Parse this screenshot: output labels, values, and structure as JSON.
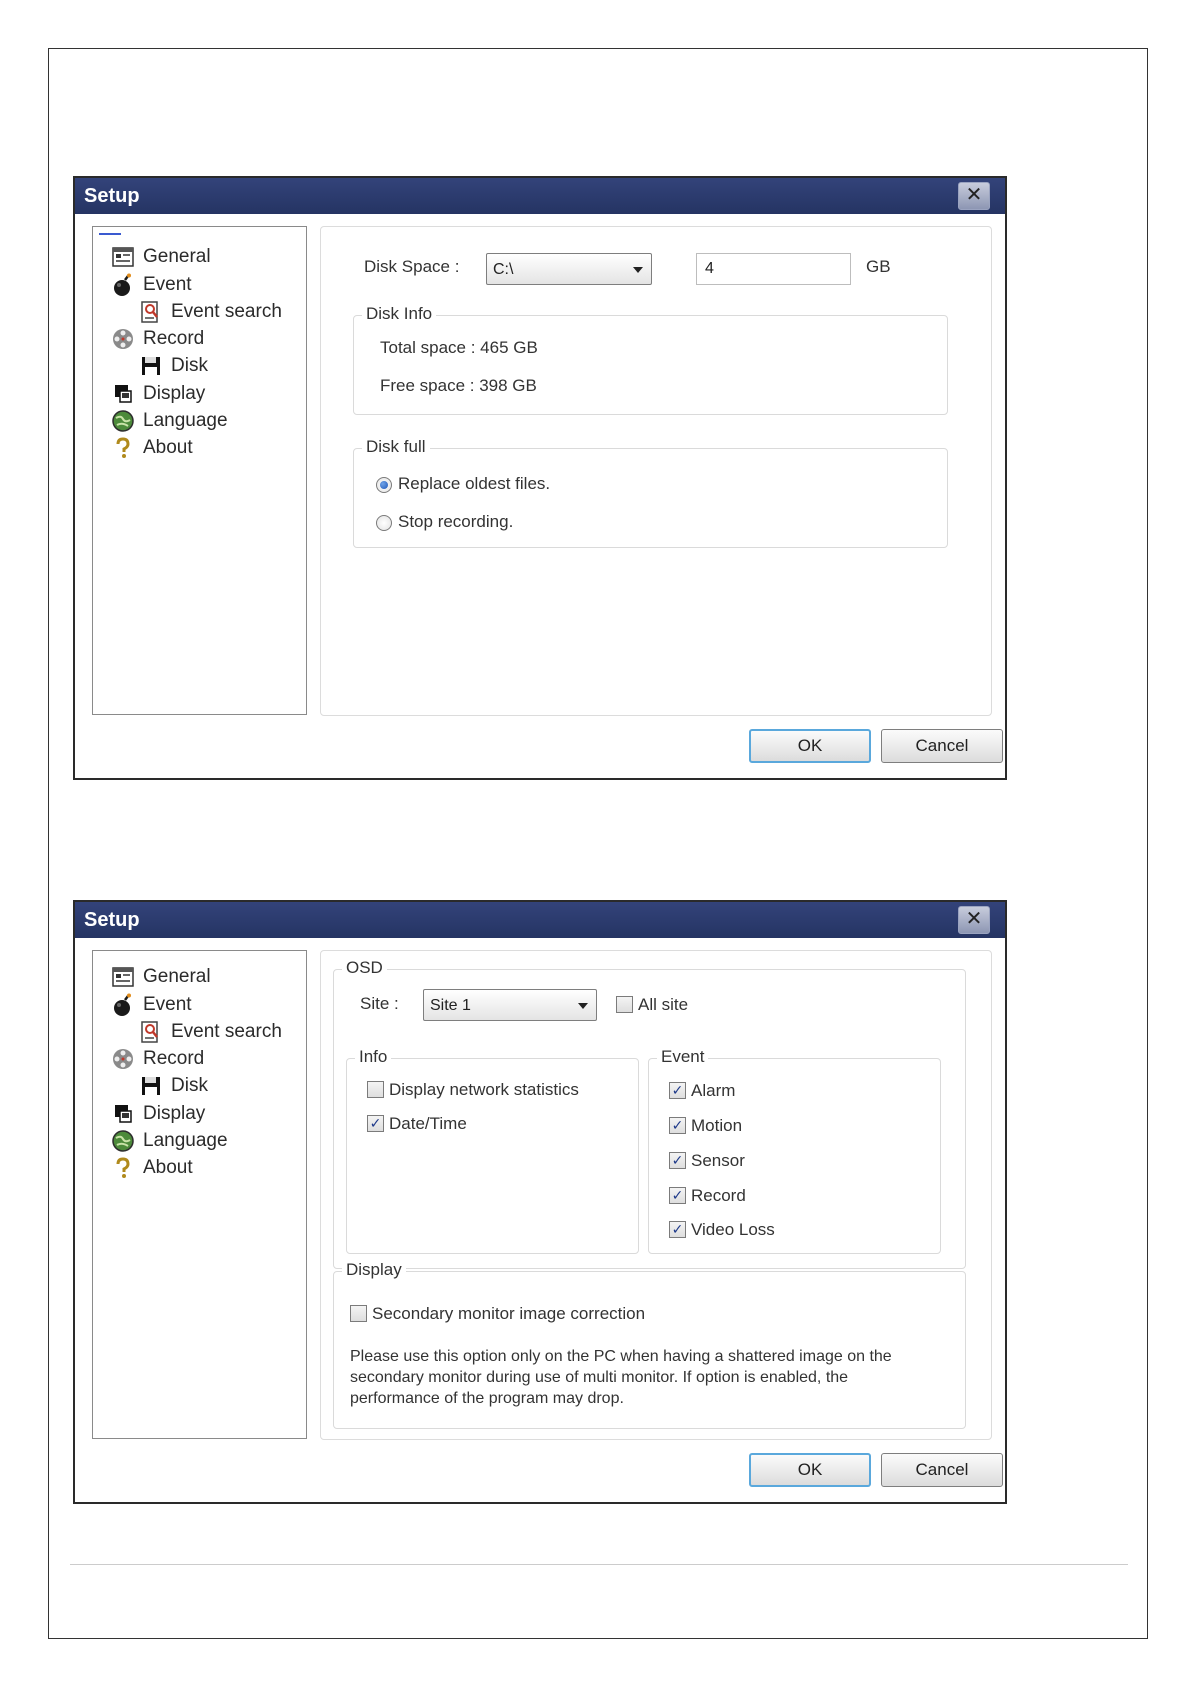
{
  "dialog1": {
    "title": "Setup",
    "close_glyph": "✕",
    "tree": [
      "General",
      "Event",
      "Event search",
      "Record",
      "Disk",
      "Display",
      "Language",
      "About"
    ],
    "disk_space_label": "Disk Space :",
    "drive_value": "C:\\",
    "size_value": "4",
    "size_unit": "GB",
    "disk_info_legend": "Disk Info",
    "total_space": "Total space : 465 GB",
    "free_space": "Free space : 398 GB",
    "disk_full_legend": "Disk full",
    "replace_oldest": "Replace oldest files.",
    "stop_recording": "Stop recording.",
    "replace_oldest_checked": true,
    "stop_recording_checked": false,
    "ok": "OK",
    "cancel": "Cancel"
  },
  "dialog2": {
    "title": "Setup",
    "close_glyph": "✕",
    "tree": [
      "General",
      "Event",
      "Event search",
      "Record",
      "Disk",
      "Display",
      "Language",
      "About"
    ],
    "osd_legend": "OSD",
    "site_label": "Site :",
    "site_value": "Site 1",
    "all_site": "All site",
    "info_legend": "Info",
    "display_network_statistics": "Display network statistics",
    "date_time": "Date/Time",
    "event_legend": "Event",
    "events": [
      "Alarm",
      "Motion",
      "Sensor",
      "Record",
      "Video Loss"
    ],
    "display_legend": "Display",
    "secondary_monitor": "Secondary monitor image correction",
    "note": "Please use this option only on the PC when having a shattered image on the secondary monitor during use of multi monitor. If option is enabled, the performance of the program may drop.",
    "ok": "OK",
    "cancel": "Cancel"
  },
  "icons": {
    "general": "general-doc-icon",
    "event": "bomb-icon",
    "event_search": "search-document-icon",
    "record": "film-reel-icon",
    "disk": "floppy-disk-icon",
    "display": "monitor-icon",
    "language": "globe-icon",
    "about": "question-mark-icon"
  },
  "colors": {
    "titlebar": "#2b3b6f",
    "default_button_border": "#5aa8dc",
    "radio_dot": "#1f57b8",
    "check_mark": "#1f3a8a"
  }
}
